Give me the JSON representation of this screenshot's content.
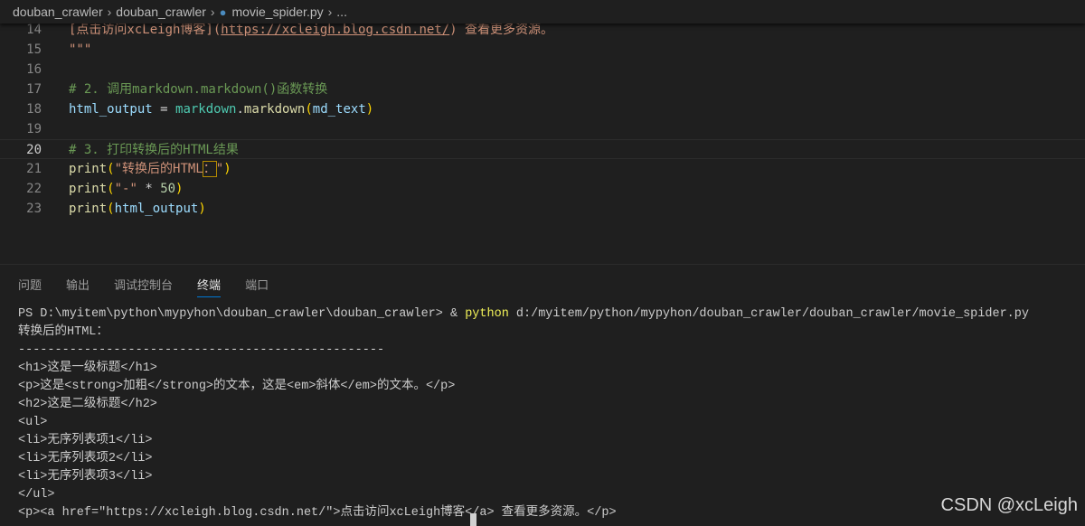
{
  "breadcrumb": [
    "douban_crawler",
    "douban_crawler",
    "movie_spider.py",
    "..."
  ],
  "code_lines": [
    {
      "n": "14",
      "tokens": [
        {
          "t": "[点击访问xcLeigh博客](",
          "c": "#ce9178"
        },
        {
          "t": "https://xcleigh.blog.csdn.net/",
          "c": "#ce9178",
          "u": true
        },
        {
          "t": ") 查看更多资源。",
          "c": "#ce9178"
        }
      ]
    },
    {
      "n": "15",
      "tokens": [
        {
          "t": "\"\"\"",
          "c": "#ce9178"
        }
      ]
    },
    {
      "n": "16",
      "tokens": []
    },
    {
      "n": "17",
      "tokens": [
        {
          "t": "# 2. 调用markdown.markdown()函数转换",
          "c": "#6a9955"
        }
      ]
    },
    {
      "n": "18",
      "tokens": [
        {
          "t": "html_output",
          "c": "#9cdcfe"
        },
        {
          "t": " = ",
          "c": "#d4d4d4"
        },
        {
          "t": "markdown",
          "c": "#4ec9b0"
        },
        {
          "t": ".",
          "c": "#d4d4d4"
        },
        {
          "t": "markdown",
          "c": "#dcdcaa"
        },
        {
          "t": "(",
          "c": "#ffd700"
        },
        {
          "t": "md_text",
          "c": "#9cdcfe"
        },
        {
          "t": ")",
          "c": "#ffd700"
        }
      ]
    },
    {
      "n": "19",
      "tokens": []
    },
    {
      "n": "20",
      "active": true,
      "tokens": [
        {
          "t": "# 3. 打印转换后的HTML结果",
          "c": "#6a9955"
        }
      ]
    },
    {
      "n": "21",
      "tokens": [
        {
          "t": "print",
          "c": "#dcdcaa"
        },
        {
          "t": "(",
          "c": "#ffd700"
        },
        {
          "t": "\"转换后的HTML",
          "c": "#ce9178"
        },
        {
          "t": "：",
          "c": "#ce9178",
          "b": true
        },
        {
          "t": "\"",
          "c": "#ce9178"
        },
        {
          "t": ")",
          "c": "#ffd700"
        }
      ]
    },
    {
      "n": "22",
      "tokens": [
        {
          "t": "print",
          "c": "#dcdcaa"
        },
        {
          "t": "(",
          "c": "#ffd700"
        },
        {
          "t": "\"-\"",
          "c": "#ce9178"
        },
        {
          "t": " * ",
          "c": "#d4d4d4"
        },
        {
          "t": "50",
          "c": "#b5cea8"
        },
        {
          "t": ")",
          "c": "#ffd700"
        }
      ]
    },
    {
      "n": "23",
      "tokens": [
        {
          "t": "print",
          "c": "#dcdcaa"
        },
        {
          "t": "(",
          "c": "#ffd700"
        },
        {
          "t": "html_output",
          "c": "#9cdcfe"
        },
        {
          "t": ")",
          "c": "#ffd700"
        }
      ]
    }
  ],
  "panel_tabs": [
    {
      "label": "问题"
    },
    {
      "label": "输出"
    },
    {
      "label": "调试控制台"
    },
    {
      "label": "终端",
      "active": true
    },
    {
      "label": "端口"
    }
  ],
  "terminal": {
    "prompt": "PS D:\\myitem\\python\\mypyhon\\douban_crawler\\douban_crawler> & ",
    "cmd": "python",
    "args": " d:/myitem/python/mypyhon/douban_crawler/douban_crawler/movie_spider.py",
    "lines": [
      "转换后的HTML：",
      "--------------------------------------------------",
      "<h1>这是一级标题</h1>",
      "<p>这是<strong>加粗</strong>的文本，这是<em>斜体</em>的文本。</p>",
      "<h2>这是二级标题</h2>",
      "<ul>",
      "<li>无序列表项1</li>",
      "<li>无序列表项2</li>",
      "<li>无序列表项3</li>",
      "</ul>",
      "<p><a href=\"https://xcleigh.blog.csdn.net/\">点击访问xcLeigh博客</a> 查看更多资源。</p>"
    ]
  },
  "watermark": "CSDN @xcLeigh"
}
